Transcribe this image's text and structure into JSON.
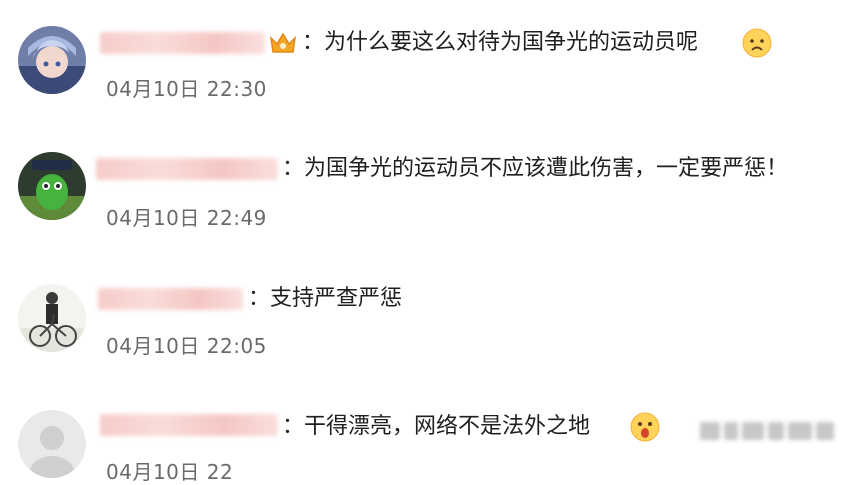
{
  "comments": [
    {
      "text": "：为什么要这么对待为国争光的运动员呢",
      "time": "04月10日 22:30",
      "avatar": "anime-character-avatar",
      "badge": "crown-badge-icon",
      "emoji": "sad-face-emoji"
    },
    {
      "text": "：为国争光的运动员不应该遭此伤害，一定要严惩！",
      "time": "04月10日 22:49",
      "avatar": "green-cartoon-avatar"
    },
    {
      "text": "：支持严查严惩",
      "time": "04月10日 22:05",
      "avatar": "person-bicycle-avatar"
    },
    {
      "text": "：干得漂亮，网络不是法外之地",
      "time": "04月10日 22",
      "avatar": "default-gray-avatar",
      "emoji": "shocked-face-emoji"
    }
  ],
  "colors": {
    "name_blur": "#f6c7c4",
    "time": "#6a6a6a",
    "text": "#1f1f1f"
  }
}
